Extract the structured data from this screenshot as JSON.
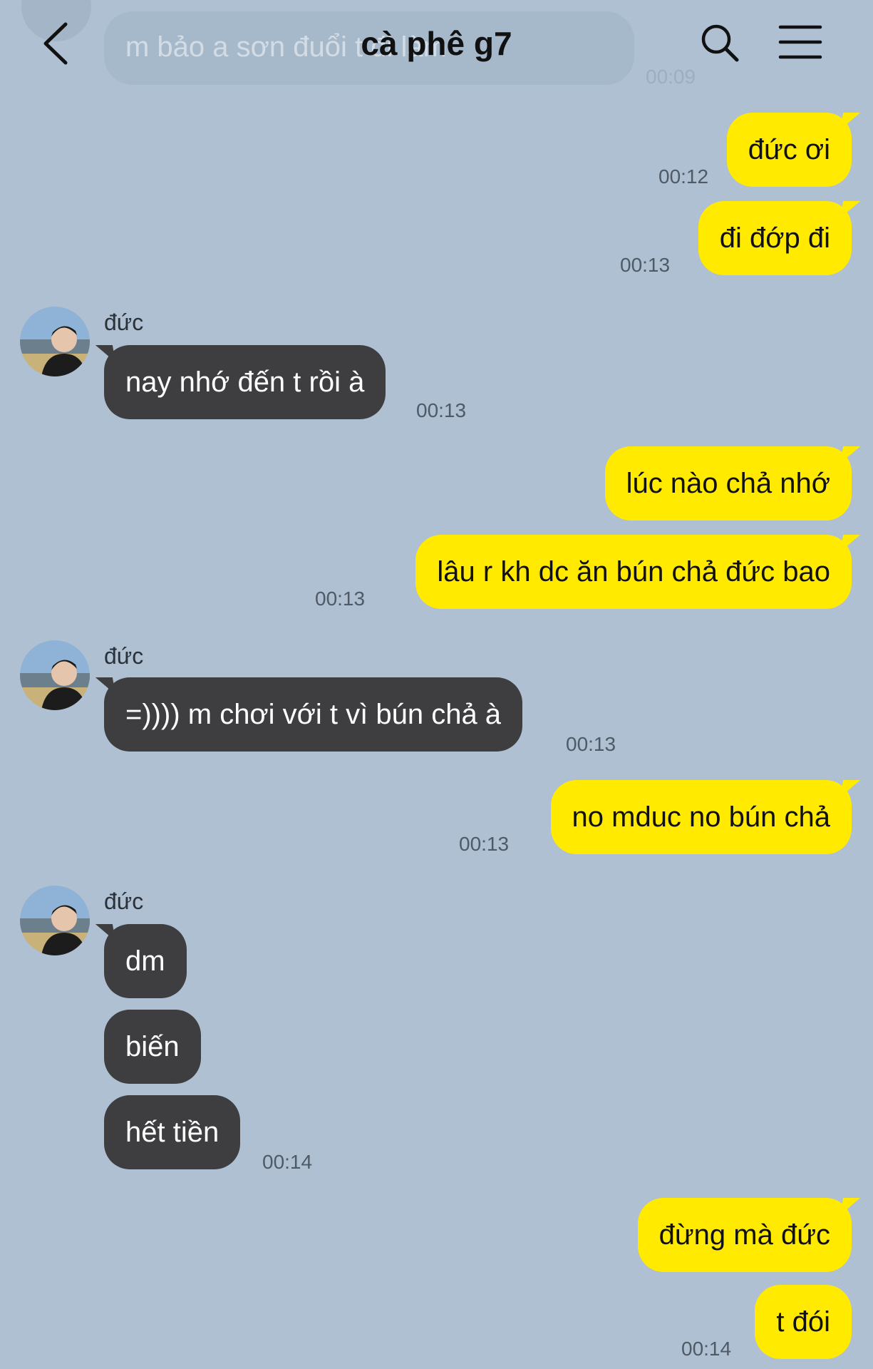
{
  "header": {
    "title": "cà phê g7",
    "ghost_message": "m bảo a sơn đuổi t đi làm",
    "ghost_time": "00:09"
  },
  "messages": [
    {
      "from": "me",
      "text": "đức ơi",
      "time": "00:12"
    },
    {
      "from": "me",
      "text": "đi đớp đi",
      "time": "00:13"
    },
    {
      "from": "them",
      "sender": "đức",
      "text": "nay nhớ đến t rồi à",
      "time": "00:13"
    },
    {
      "from": "me",
      "text": "lúc nào chả nhớ"
    },
    {
      "from": "me",
      "text": "lâu r kh dc ăn bún chả đức bao",
      "time": "00:13"
    },
    {
      "from": "them",
      "sender": "đức",
      "text": "=)))) m chơi với t vì bún chả à",
      "time": "00:13"
    },
    {
      "from": "me",
      "text": "no mduc no bún chả",
      "time": "00:13"
    },
    {
      "from": "them",
      "sender": "đức",
      "text": "dm"
    },
    {
      "from": "them",
      "text": "biến"
    },
    {
      "from": "them",
      "text": "hết tiền",
      "time": "00:14"
    },
    {
      "from": "me",
      "text": "đừng mà đức"
    },
    {
      "from": "me",
      "text": "t đói",
      "time": "00:14"
    }
  ],
  "colors": {
    "background": "#aec0d2",
    "my_bubble": "#ffea00",
    "their_bubble": "#3e3e40"
  }
}
